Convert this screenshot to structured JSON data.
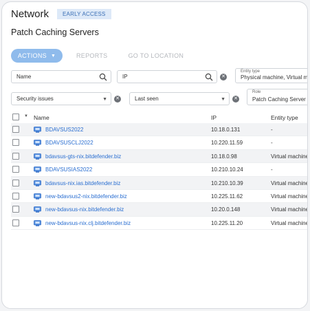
{
  "header": {
    "title": "Network",
    "badge": "EARLY ACCESS",
    "subtitle": "Patch Caching Servers"
  },
  "toolbar": {
    "actions_label": "ACTIONS",
    "reports_label": "REPORTS",
    "goto_label": "GO TO LOCATION"
  },
  "filters": {
    "name": "Name",
    "ip": "IP",
    "entity_type_label": "Entity type",
    "entity_type_value": "Physical machine, Virtual ma...",
    "security_issues": "Security issues",
    "last_seen": "Last seen",
    "role_label": "Role",
    "role_value": "Patch Caching Server"
  },
  "table": {
    "columns": [
      "Name",
      "IP",
      "Entity type"
    ],
    "rows": [
      {
        "name": "BDAVSUS2022",
        "ip": "10.18.0.131",
        "type": "-"
      },
      {
        "name": "BDAVSUSCLJ2022",
        "ip": "10.220.11.59",
        "type": "-"
      },
      {
        "name": "bdavsus-gts-nix.bitdefender.biz",
        "ip": "10.18.0.98",
        "type": "Virtual machine"
      },
      {
        "name": "BDAVSUSIAS2022",
        "ip": "10.210.10.24",
        "type": "-"
      },
      {
        "name": "bdavsus-nix.ias.bitdefender.biz",
        "ip": "10.210.10.39",
        "type": "Virtual machine"
      },
      {
        "name": "new-bdavsus2-nix.bitdefender.biz",
        "ip": "10.225.11.62",
        "type": "Virtual machine"
      },
      {
        "name": "new-bdavsus-nix.bitdefender.biz",
        "ip": "10.20.0.148",
        "type": "Virtual machine"
      },
      {
        "name": "new-bdavsus-nix.clj.bitdefender.biz",
        "ip": "10.225.11.20",
        "type": "Virtual machine"
      }
    ]
  },
  "icons": {
    "search": "search-icon",
    "clear": "clear-icon",
    "row": "server-icon"
  },
  "colors": {
    "accent": "#8fbbec",
    "link": "#2b6fd1",
    "badge_bg": "#dde9f8",
    "badge_text": "#3b6fb5"
  }
}
